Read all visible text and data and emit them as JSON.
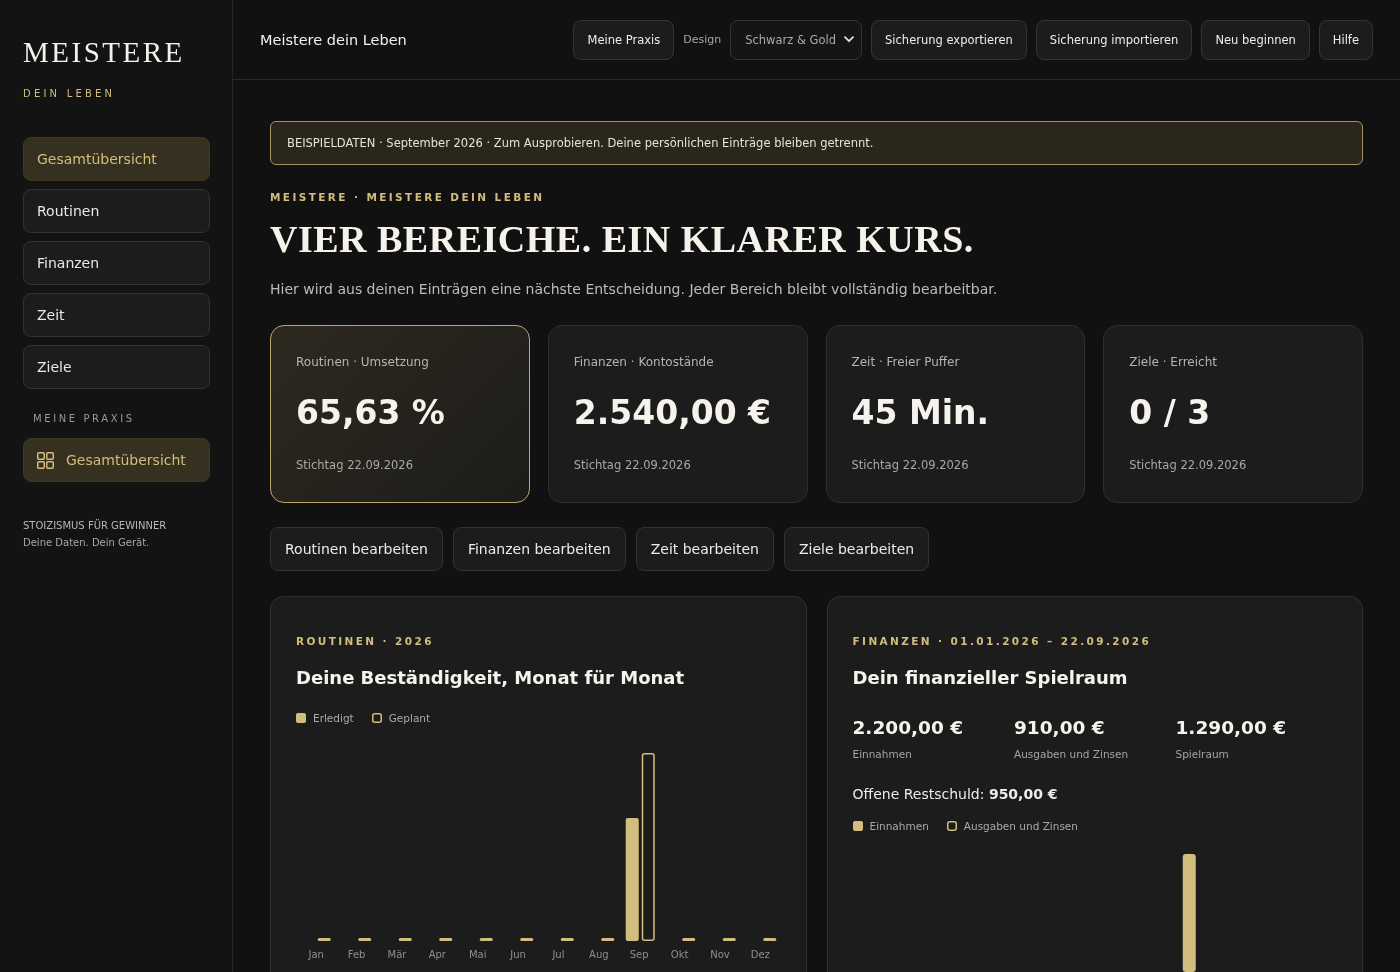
{
  "sidebar": {
    "logo": "MEISTERE",
    "tagline": "DEIN LEBEN",
    "nav": [
      {
        "label": "Gesamtübersicht",
        "selected": true
      },
      {
        "label": "Routinen",
        "selected": false
      },
      {
        "label": "Finanzen",
        "selected": false
      },
      {
        "label": "Zeit",
        "selected": false
      },
      {
        "label": "Ziele",
        "selected": false
      }
    ],
    "section_label": "MEINE PRAXIS",
    "practice_items": [
      {
        "label": "Gesamtübersicht",
        "selected": true
      }
    ],
    "footer": {
      "title": "STOIZISMUS FÜR GEWINNER",
      "note": "Deine Daten. Dein Gerät."
    }
  },
  "header": {
    "title": "Meistere dein Leben",
    "toolbar": [
      {
        "kind": "button",
        "label": "Meine Praxis"
      },
      {
        "kind": "label",
        "label": "Design"
      },
      {
        "kind": "select",
        "value": "Schwarz & Gold"
      },
      {
        "kind": "button",
        "label": "Sicherung exportieren"
      },
      {
        "kind": "button",
        "label": "Sicherung importieren"
      },
      {
        "kind": "button",
        "label": "Neu beginnen"
      },
      {
        "kind": "button",
        "label": "Hilfe"
      }
    ]
  },
  "banner": "BEISPIELDATEN · September 2026 · Zum Ausprobieren. Deine persönlichen Einträge bleiben getrennt.",
  "eyebrow": "MEISTERE · MEISTERE DEIN LEBEN",
  "title": "VIER BEREICHE. EIN KLARER KURS.",
  "intro": "Hier wird aus deinen Einträgen eine nächste Entscheidung. Jeder Bereich bleibt vollständig bearbeitbar.",
  "kpis": [
    {
      "label": "Routinen · Umsetzung",
      "value": "65,63 %",
      "note": "Stichtag 22.09.2026",
      "selected": true
    },
    {
      "label": "Finanzen · Kontostände",
      "value": "2.540,00 €",
      "note": "Stichtag 22.09.2026",
      "selected": false
    },
    {
      "label": "Zeit · Freier Puffer",
      "value": "45 Min.",
      "note": "Stichtag 22.09.2026",
      "selected": false
    },
    {
      "label": "Ziele · Erreicht",
      "value": "0 / 3",
      "note": "Stichtag 22.09.2026",
      "selected": false
    }
  ],
  "edit_buttons": [
    "Routinen bearbeiten",
    "Finanzen bearbeiten",
    "Zeit bearbeiten",
    "Ziele bearbeiten"
  ],
  "routines_panel": {
    "eyebrow": "ROUTINEN · 2026",
    "title": "Deine Beständigkeit, Monat für Monat",
    "legend": [
      {
        "label": "Erledigt",
        "kind": "filled"
      },
      {
        "label": "Geplant",
        "kind": "outline"
      }
    ],
    "months": [
      "Jan",
      "Feb",
      "Mär",
      "Apr",
      "Mai",
      "Jun",
      "Jul",
      "Aug",
      "Sep",
      "Okt",
      "Nov",
      "Dez"
    ]
  },
  "finance_panel": {
    "eyebrow": "FINANZEN · 01.01.2026 – 22.09.2026",
    "title": "Dein finanzieller Spielraum",
    "stats": [
      {
        "value": "2.200,00 €",
        "label": "Einnahmen"
      },
      {
        "value": "910,00 €",
        "label": "Ausgaben und Zinsen"
      },
      {
        "value": "1.290,00 €",
        "label": "Spielraum"
      }
    ],
    "debt": "Offene Restschuld: **950,00 €**",
    "legend": [
      {
        "label": "Einnahmen",
        "kind": "filled"
      },
      {
        "label": "Ausgaben und Zinsen",
        "kind": "outline"
      }
    ]
  }
}
